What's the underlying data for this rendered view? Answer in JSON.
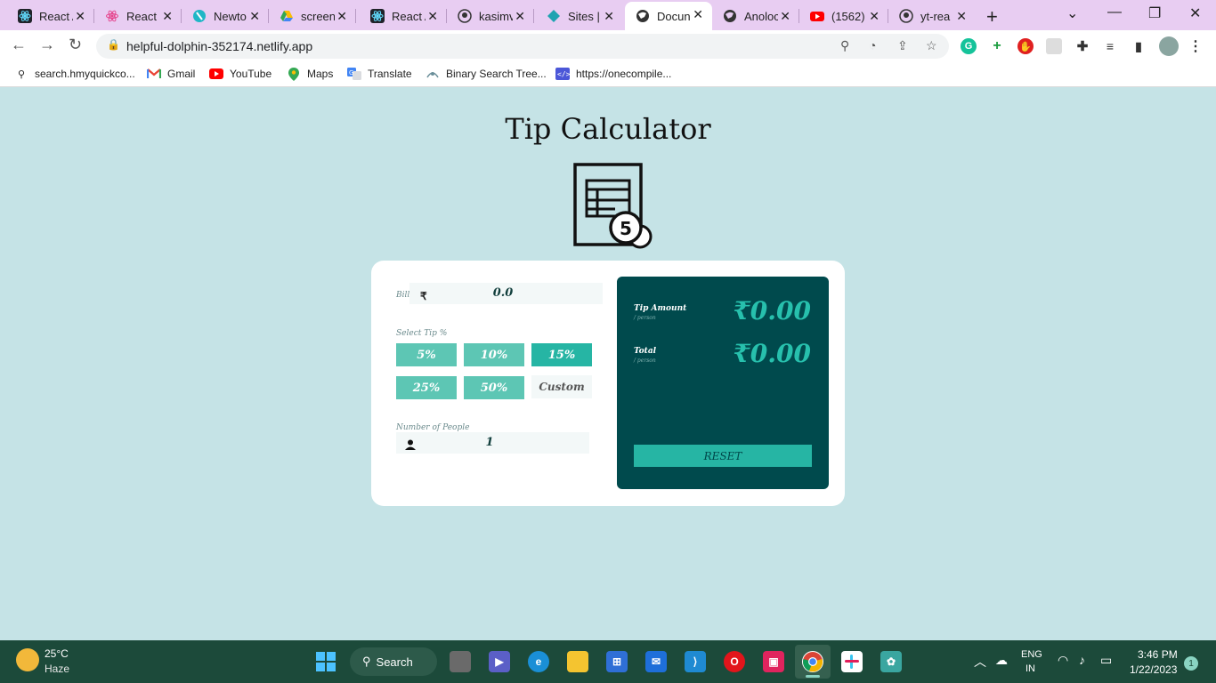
{
  "browser": {
    "tabs": [
      {
        "title": "React A",
        "icon": "react-icon"
      },
      {
        "title": "React I",
        "icon": "react-icon"
      },
      {
        "title": "Newto",
        "icon": "newton-icon"
      },
      {
        "title": "screen",
        "icon": "drive-icon"
      },
      {
        "title": "React A",
        "icon": "react-icon"
      },
      {
        "title": "kasimv",
        "icon": "github-icon"
      },
      {
        "title": "Sites |",
        "icon": "netlify-icon"
      },
      {
        "title": "Docun",
        "icon": "globe-icon"
      },
      {
        "title": "Anoloc",
        "icon": "globe-icon"
      },
      {
        "title": "(1562)",
        "icon": "youtube-icon"
      },
      {
        "title": "yt-rea",
        "icon": "github-icon"
      }
    ],
    "url": "helpful-dolphin-352174.netlify.app",
    "bookmarks": [
      {
        "label": "search.hmyquickco...",
        "icon": "search-icon"
      },
      {
        "label": "Gmail",
        "icon": "gmail-icon"
      },
      {
        "label": "YouTube",
        "icon": "youtube-icon"
      },
      {
        "label": "Maps",
        "icon": "maps-icon"
      },
      {
        "label": "Translate",
        "icon": "translate-icon"
      },
      {
        "label": "Binary Search Tree...",
        "icon": "bst-icon"
      },
      {
        "label": "https://onecompile...",
        "icon": "code-icon"
      }
    ]
  },
  "app": {
    "title": "Tip Calculator",
    "bill_label": "Bill",
    "currency_symbol": "₹",
    "bill_value": "0.0",
    "select_tip_label": "Select Tip %",
    "tip_options": [
      "5%",
      "10%",
      "15%",
      "25%",
      "50%"
    ],
    "selected_tip": "15%",
    "custom_label": "Custom",
    "people_label": "Number of People",
    "people_value": "1",
    "tip_amount_label": "Tip Amount",
    "tip_amount_sub": "/ person",
    "tip_amount_value": "₹0.00",
    "total_label": "Total",
    "total_sub": "/ person",
    "total_value": "₹0.00",
    "reset_label": "RESET",
    "colors": {
      "background": "#c5e3e6",
      "panel": "#004a4d",
      "accent": "#26b5a4",
      "button": "#5dc6b4"
    }
  },
  "taskbar": {
    "temperature": "25°C",
    "weather": "Haze",
    "search_label": "Search",
    "language_1": "ENG",
    "language_2": "IN",
    "time": "3:46 PM",
    "date": "1/22/2023",
    "notification_count": "1"
  }
}
